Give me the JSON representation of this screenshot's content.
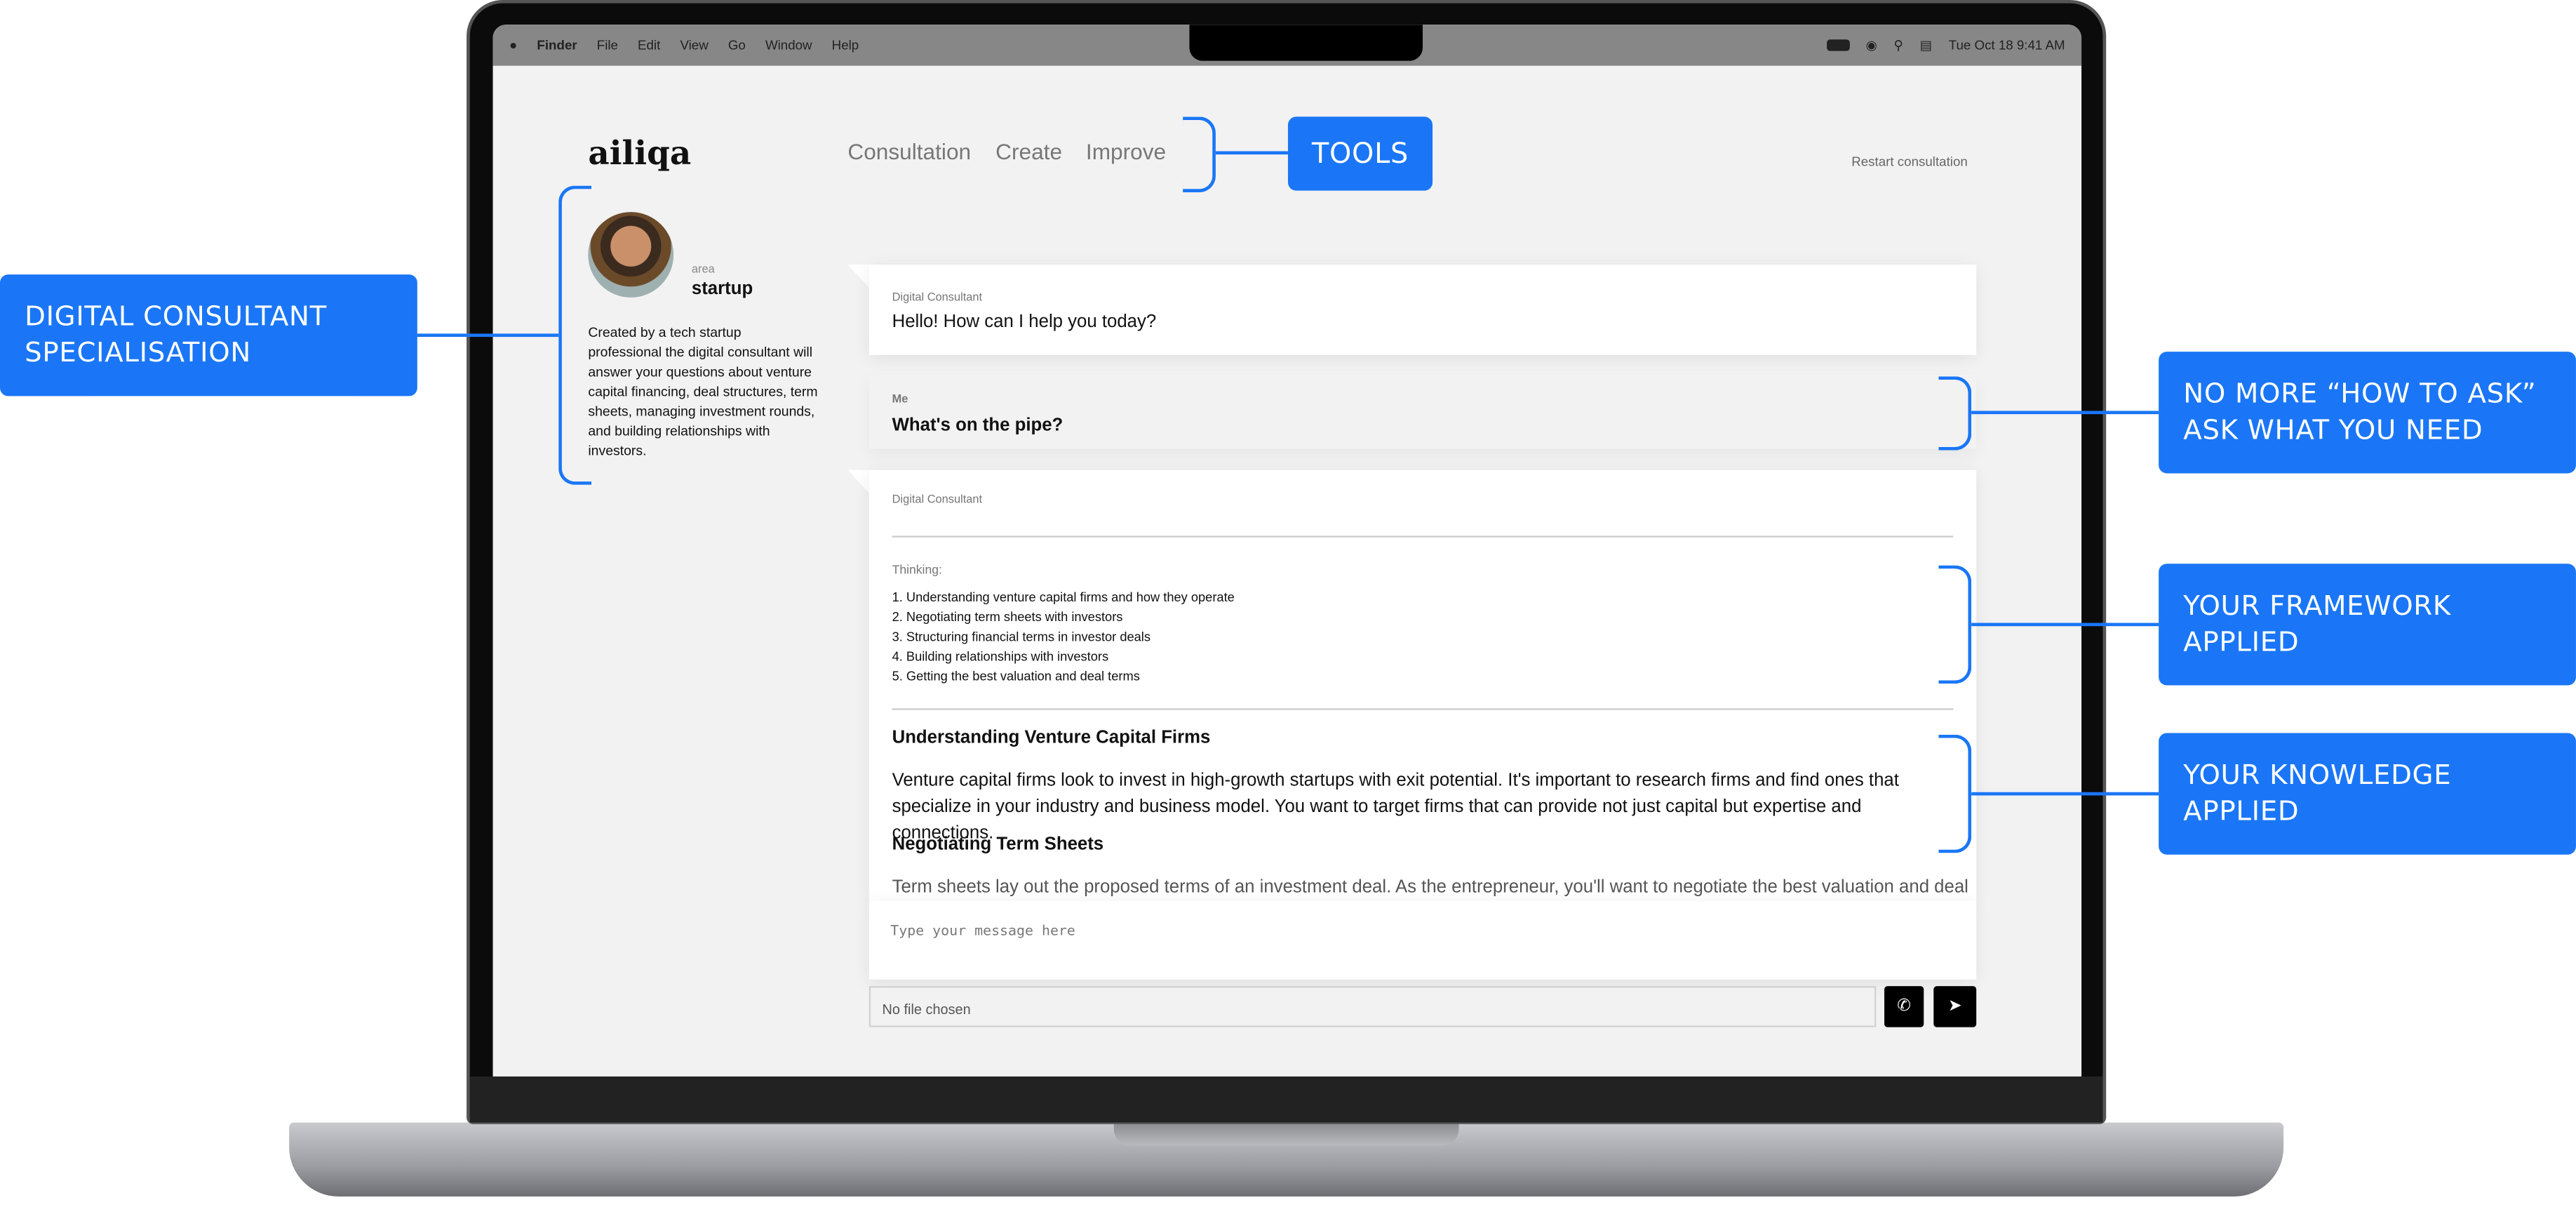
{
  "menubar": {
    "apple": "",
    "items": [
      "Finder",
      "File",
      "Edit",
      "View",
      "Go",
      "Window",
      "Help"
    ],
    "clock": "Tue Oct 18  9:41 AM"
  },
  "app": {
    "logo": "ailiqa",
    "nav": [
      "Consultation",
      "Create",
      "Improve"
    ],
    "restart": "Restart consultation"
  },
  "profile": {
    "area_label": "area",
    "area": "startup",
    "description": "Created by a tech startup professional the digital consultant will answer your questions about venture capital financing, deal structures, term sheets, managing investment rounds, and building relationships with investors."
  },
  "chat": [
    {
      "sender": "Digital Consultant",
      "text": "Hello! How can I help you today?"
    },
    {
      "sender": "Me",
      "text": "What's on the pipe?"
    }
  ],
  "response": {
    "sender": "Digital Consultant",
    "thinking_label": "Thinking:",
    "thinking": [
      "1. Understanding venture capital firms and how they operate",
      "2. Negotiating term sheets with investors",
      "3. Structuring financial terms in investor deals",
      "4. Building relationships with investors",
      "5. Getting the best valuation and deal terms"
    ],
    "h1": "Understanding Venture Capital Firms",
    "p1": "Venture capital firms look to invest in high-growth startups with exit potential. It's important to research firms and find ones that specialize in your industry and business model. You want to target firms that can provide not just capital but expertise and connections.",
    "h2": "Negotiating Term Sheets",
    "p2": "Term sheets lay out the proposed terms of an investment deal. As the entrepreneur, you'll want to negotiate the best valuation and deal"
  },
  "composer": {
    "placeholder": "Type your message here",
    "file": "No file chosen",
    "call_icon": "phone-icon",
    "send_icon": "send-icon"
  },
  "annotations": {
    "tools": "TOOLS",
    "specialisation": [
      "DIGITAL CONSULTANT",
      "SPECIALISATION"
    ],
    "ask": [
      "NO MORE “HOW TO ASK”",
      "ASK WHAT YOU NEED"
    ],
    "framework": [
      "YOUR FRAMEWORK",
      "APPLIED"
    ],
    "knowledge": [
      "YOUR KNOWLEDGE",
      "APPLIED"
    ]
  },
  "colors": {
    "accent": "#1a76f6",
    "background": "#f2f2f2"
  }
}
